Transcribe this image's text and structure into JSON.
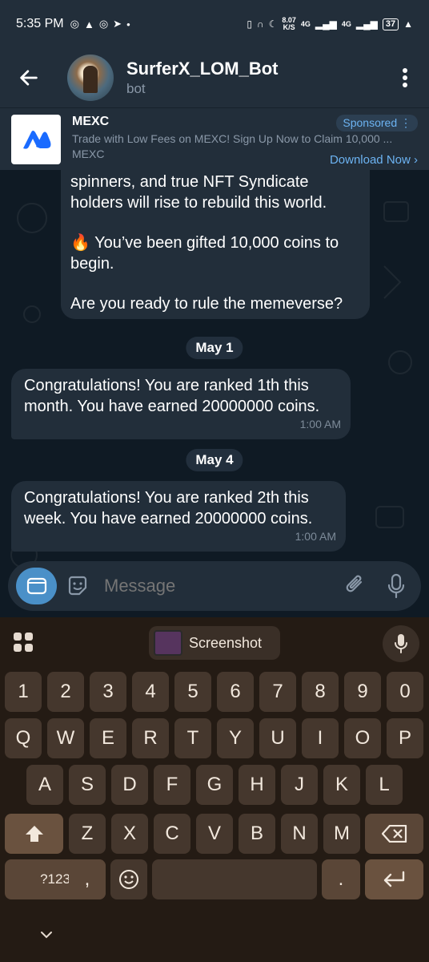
{
  "status_bar": {
    "time": "5:35 PM",
    "net_speed_value": "8.07",
    "net_speed_unit": "K/S",
    "network_labels": [
      "4G",
      "4G"
    ],
    "battery": "37"
  },
  "header": {
    "title": "SurferX_LOM_Bot",
    "subtitle": "bot"
  },
  "ad": {
    "name": "MEXC",
    "text": "Trade with Low Fees on MEXC! Sign Up Now to Claim 10,000 ...",
    "brand": "MEXC",
    "badge": "Sponsored",
    "cta": "Download Now"
  },
  "messages": [
    {
      "lines": [
        "spinners, and true NFT Syndicate",
        "holders will rise to rebuild this world.",
        "",
        "🔥 You’ve been gifted 10,000 coins to",
        "begin.",
        "",
        "Are you ready to rule the memeverse?"
      ]
    },
    {
      "date": "May 1",
      "lines": [
        "Congratulations! You are ranked 1th this",
        "month. You have earned 20000000 coins."
      ],
      "time": "1:00 AM"
    },
    {
      "date": "May 4",
      "lines": [
        "Congratulations! You are ranked 2th this",
        "week. You have earned 20000000 coins."
      ],
      "time": "1:00 AM"
    }
  ],
  "composer": {
    "placeholder": "Message"
  },
  "keyboard": {
    "suggestion_chip": "Screenshot",
    "rows": [
      [
        "1",
        "2",
        "3",
        "4",
        "5",
        "6",
        "7",
        "8",
        "9",
        "0"
      ],
      [
        "Q",
        "W",
        "E",
        "R",
        "T",
        "Y",
        "U",
        "I",
        "O",
        "P"
      ],
      [
        "A",
        "S",
        "D",
        "F",
        "G",
        "H",
        "J",
        "K",
        "L"
      ],
      [
        "Z",
        "X",
        "C",
        "V",
        "B",
        "N",
        "M"
      ]
    ],
    "symbols_label": "?123",
    "comma_label": ",",
    "period_label": "."
  },
  "icons": [
    "back-arrow-icon",
    "more-vertical-icon",
    "emoji-sticker-icon",
    "attach-icon",
    "mic-icon",
    "keyboard-toggle-icon",
    "grid-icon",
    "shift-icon",
    "backspace-icon",
    "enter-icon",
    "emoji-key-icon",
    "chevron-down-icon"
  ],
  "colors": {
    "accent": "#6cb3f2",
    "bubble": "#222e3a",
    "chat_bg": "#0f1a24"
  }
}
